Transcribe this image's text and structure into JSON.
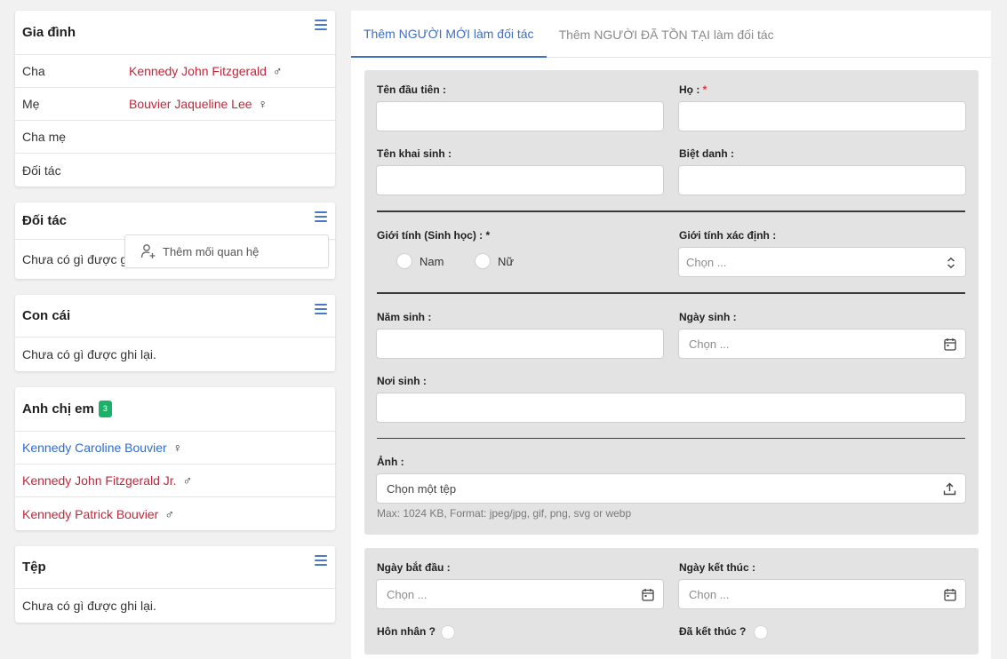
{
  "family": {
    "title": "Gia đình",
    "rows": [
      {
        "label": "Cha",
        "value": "Kennedy John Fitzgerald",
        "sex": "♂"
      },
      {
        "label": "Mẹ",
        "value": "Bouvier Jaqueline Lee",
        "sex": "♀"
      },
      {
        "label": "Cha mẹ",
        "value": "",
        "sex": ""
      },
      {
        "label": "Đối tác",
        "value": "",
        "sex": ""
      }
    ]
  },
  "partners": {
    "title": "Đối tác",
    "empty": "Chưa có gì được ghi lại.",
    "popup_label": "Thêm mối quan hệ"
  },
  "children": {
    "title": "Con cái",
    "empty": "Chưa có gì được ghi lại."
  },
  "siblings": {
    "title": "Anh chị em",
    "count": "3",
    "items": [
      {
        "name": "Kennedy Caroline Bouvier",
        "sex": "♀"
      },
      {
        "name": "Kennedy John Fitzgerald Jr.",
        "sex": "♂"
      },
      {
        "name": "Kennedy Patrick Bouvier",
        "sex": "♂"
      }
    ]
  },
  "files": {
    "title": "Tệp",
    "empty": "Chưa có gì được ghi lại."
  },
  "tabs": [
    {
      "label": "Thêm NGƯỜI MỚI làm đối tác"
    },
    {
      "label": "Thêm NGƯỜI ĐÃ TỒN TẠI làm đối tác"
    }
  ],
  "form": {
    "first_name": "Tên đầu tiên :",
    "last_name": "Họ :",
    "last_name_req": "*",
    "birth_name": "Tên khai sinh :",
    "nickname": "Biệt danh :",
    "sex": "Giới tính (Sinh học) : *",
    "sex_male": "Nam",
    "sex_female": "Nữ",
    "gender": "Giới tính xác định :",
    "gender_placeholder": "Chọn ...",
    "birth_year": "Năm sinh :",
    "birth_date": "Ngày sinh :",
    "birth_date_placeholder": "Chọn ...",
    "birth_place": "Nơi sinh :",
    "photo": "Ảnh :",
    "photo_placeholder": "Chọn một tệp",
    "photo_hint": "Max: 1024 KB, Format: jpeg/jpg, gif, png, svg or webp"
  },
  "relation": {
    "start_date": "Ngày bắt đầu :",
    "start_placeholder": "Chọn ...",
    "end_date": "Ngày kết thúc :",
    "end_placeholder": "Chọn ...",
    "married": "Hôn nhân ?",
    "ended": "Đã kết thúc ?"
  }
}
